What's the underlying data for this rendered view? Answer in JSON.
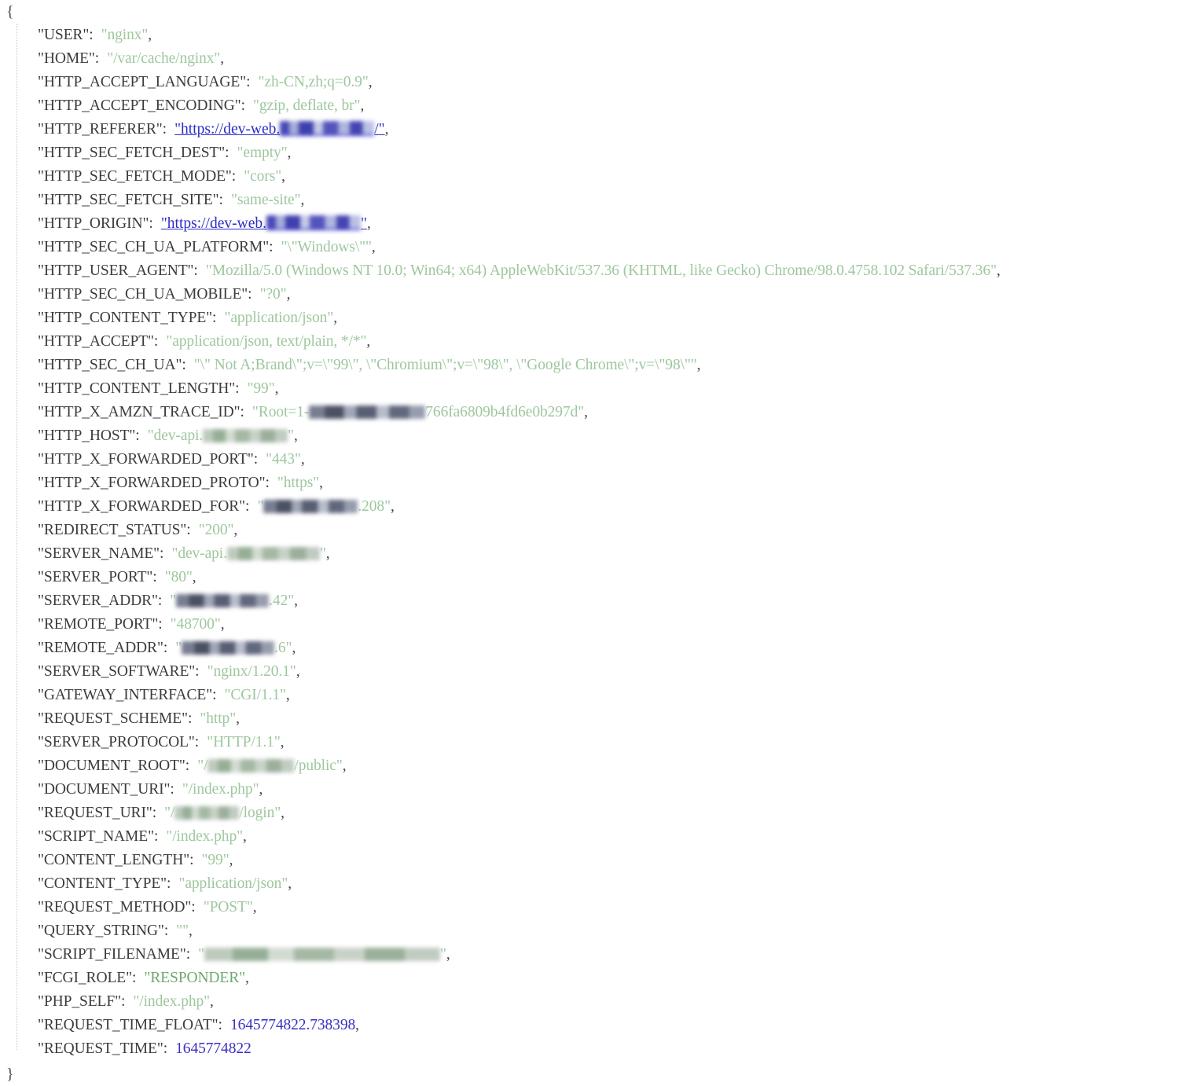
{
  "document": {
    "type": "json-dump",
    "title": "PHP $_SERVER JSON dump",
    "open_brace": "{",
    "close_brace": "}",
    "colon": ":",
    "comma": ",",
    "quote": "\""
  },
  "colors": {
    "key": "#3b3b3b",
    "string_value": "#9ec79e",
    "string_value_strong": "#6fa86f",
    "number_value": "#3a31c4",
    "link_value": "#2b2bc9",
    "background": "#ffffff",
    "indent_guide": "#c9c9c9"
  },
  "entries": [
    {
      "key": "USER",
      "value": "nginx",
      "type": "string",
      "trailing_comma": true
    },
    {
      "key": "HOME",
      "value": "/var/cache/nginx",
      "type": "string",
      "trailing_comma": true
    },
    {
      "key": "HTTP_ACCEPT_LANGUAGE",
      "value": "zh-CN,zh;q=0.9",
      "type": "string",
      "trailing_comma": true
    },
    {
      "key": "HTTP_ACCEPT_ENCODING",
      "value": "gzip, deflate, br",
      "type": "string",
      "trailing_comma": true
    },
    {
      "key": "HTTP_REFERER",
      "value_prefix": "https://dev-web.",
      "value_suffix": "/",
      "type": "link",
      "redacted": true,
      "redaction_width": 120,
      "trailing_comma": true
    },
    {
      "key": "HTTP_SEC_FETCH_DEST",
      "value": "empty",
      "type": "string",
      "trailing_comma": true
    },
    {
      "key": "HTTP_SEC_FETCH_MODE",
      "value": "cors",
      "type": "string",
      "trailing_comma": true
    },
    {
      "key": "HTTP_SEC_FETCH_SITE",
      "value": "same-site",
      "type": "string",
      "trailing_comma": true
    },
    {
      "key": "HTTP_ORIGIN",
      "value_prefix": "https://dev-web.",
      "value_suffix": "",
      "type": "link",
      "redacted": true,
      "redaction_width": 120,
      "trailing_comma": true
    },
    {
      "key": "HTTP_SEC_CH_UA_PLATFORM",
      "value": "\\\"Windows\\\"",
      "type": "string",
      "trailing_comma": true
    },
    {
      "key": "HTTP_USER_AGENT",
      "value": "Mozilla/5.0 (Windows NT 10.0; Win64; x64) AppleWebKit/537.36 (KHTML, like Gecko) Chrome/98.0.4758.102 Safari/537.36",
      "type": "string",
      "trailing_comma": true
    },
    {
      "key": "HTTP_SEC_CH_UA_MOBILE",
      "value": "?0",
      "type": "string",
      "trailing_comma": true
    },
    {
      "key": "HTTP_CONTENT_TYPE",
      "value": "application/json",
      "type": "string",
      "trailing_comma": true
    },
    {
      "key": "HTTP_ACCEPT",
      "value": "application/json, text/plain, */*",
      "type": "string",
      "trailing_comma": true
    },
    {
      "key": "HTTP_SEC_CH_UA",
      "value": "\\\" Not A;Brand\\\";v=\\\"99\\\", \\\"Chromium\\\";v=\\\"98\\\", \\\"Google Chrome\\\";v=\\\"98\\\"",
      "type": "string",
      "trailing_comma": true
    },
    {
      "key": "HTTP_CONTENT_LENGTH",
      "value": "99",
      "type": "string",
      "trailing_comma": true
    },
    {
      "key": "HTTP_X_AMZN_TRACE_ID",
      "value_prefix": "Root=1-",
      "value_suffix": "766fa6809b4fd6e0b297d",
      "type": "string",
      "redacted": true,
      "redaction_width": 148,
      "trailing_comma": true
    },
    {
      "key": "HTTP_HOST",
      "value_prefix": "dev-api.",
      "value_suffix": "",
      "type": "string",
      "redacted": true,
      "redaction_width": 108,
      "trailing_comma": true
    },
    {
      "key": "HTTP_X_FORWARDED_PORT",
      "value": "443",
      "type": "string",
      "trailing_comma": true
    },
    {
      "key": "HTTP_X_FORWARDED_PROTO",
      "value": "https",
      "type": "string",
      "trailing_comma": true
    },
    {
      "key": "HTTP_X_FORWARDED_FOR",
      "value_prefix": "",
      "value_suffix": ".208",
      "type": "string",
      "redacted": true,
      "redaction_width": 120,
      "trailing_comma": true
    },
    {
      "key": "REDIRECT_STATUS",
      "value": "200",
      "type": "string",
      "trailing_comma": true
    },
    {
      "key": "SERVER_NAME",
      "value_prefix": "dev-api.",
      "value_suffix": "",
      "type": "string",
      "redacted": true,
      "redaction_width": 118,
      "trailing_comma": true
    },
    {
      "key": "SERVER_PORT",
      "value": "80",
      "type": "string",
      "trailing_comma": true
    },
    {
      "key": "SERVER_ADDR",
      "value_prefix": "",
      "value_suffix": ".42",
      "type": "string",
      "redacted": true,
      "redaction_width": 118,
      "trailing_comma": true
    },
    {
      "key": "REMOTE_PORT",
      "value": "48700",
      "type": "string",
      "trailing_comma": true
    },
    {
      "key": "REMOTE_ADDR",
      "value_prefix": "",
      "value_suffix": ".6",
      "type": "string",
      "redacted": true,
      "redaction_width": 118,
      "trailing_comma": true
    },
    {
      "key": "SERVER_SOFTWARE",
      "value": "nginx/1.20.1",
      "type": "string",
      "trailing_comma": true
    },
    {
      "key": "GATEWAY_INTERFACE",
      "value": "CGI/1.1",
      "type": "string",
      "trailing_comma": true
    },
    {
      "key": "REQUEST_SCHEME",
      "value": "http",
      "type": "string",
      "trailing_comma": true
    },
    {
      "key": "SERVER_PROTOCOL",
      "value": "HTTP/1.1",
      "type": "string",
      "trailing_comma": true
    },
    {
      "key": "DOCUMENT_ROOT",
      "value_prefix": "/",
      "value_suffix": "/public",
      "type": "string",
      "redacted": true,
      "redaction_width": 110,
      "trailing_comma": true
    },
    {
      "key": "DOCUMENT_URI",
      "value": "/index.php",
      "type": "string",
      "trailing_comma": true
    },
    {
      "key": "REQUEST_URI",
      "value_prefix": "/",
      "value_suffix": "/login",
      "type": "string",
      "redacted": true,
      "redaction_width": 82,
      "trailing_comma": true
    },
    {
      "key": "SCRIPT_NAME",
      "value": "/index.php",
      "type": "string",
      "trailing_comma": true
    },
    {
      "key": "CONTENT_LENGTH",
      "value": "99",
      "type": "string",
      "trailing_comma": true
    },
    {
      "key": "CONTENT_TYPE",
      "value": "application/json",
      "type": "string",
      "trailing_comma": true
    },
    {
      "key": "REQUEST_METHOD",
      "value": "POST",
      "type": "string",
      "trailing_comma": true
    },
    {
      "key": "QUERY_STRING",
      "value": "",
      "type": "string",
      "trailing_comma": true
    },
    {
      "key": "SCRIPT_FILENAME",
      "value_prefix": "",
      "value_suffix": "",
      "type": "string",
      "redacted": true,
      "redaction_width": 300,
      "trailing_comma": true
    },
    {
      "key": "FCGI_ROLE",
      "value": "RESPONDER",
      "type": "string-strong",
      "trailing_comma": true
    },
    {
      "key": "PHP_SELF",
      "value": "/index.php",
      "type": "string",
      "trailing_comma": true
    },
    {
      "key": "REQUEST_TIME_FLOAT",
      "value": "1645774822.738398",
      "type": "number",
      "trailing_comma": true
    },
    {
      "key": "REQUEST_TIME",
      "value": "1645774822",
      "type": "number",
      "trailing_comma": false
    }
  ]
}
